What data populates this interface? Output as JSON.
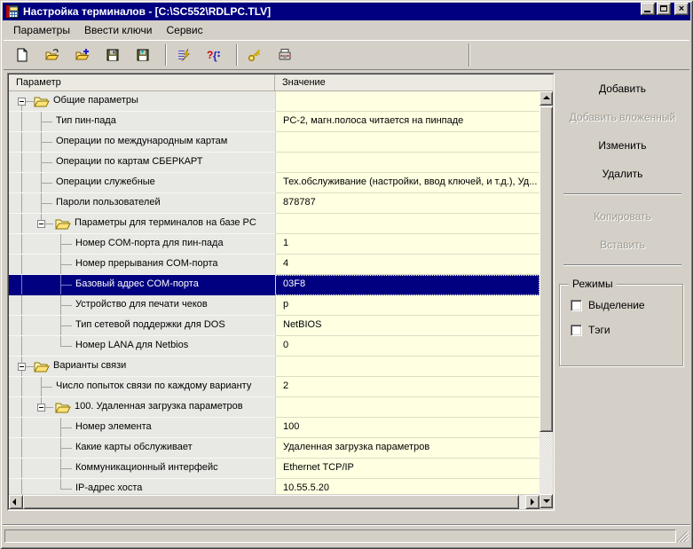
{
  "window": {
    "title": "Настройка терминалов - [C:\\SC552\\RDLPC.TLV]",
    "icon": "terminal-app-icon",
    "controls": [
      "minimize",
      "maximize",
      "close"
    ]
  },
  "menu": {
    "items": [
      {
        "label": "Параметры"
      },
      {
        "label": "Ввести ключи"
      },
      {
        "label": "Сервис"
      }
    ]
  },
  "toolbar": {
    "items": [
      {
        "type": "button",
        "icon": "new-file-icon"
      },
      {
        "type": "button",
        "icon": "open-file-icon"
      },
      {
        "type": "button",
        "icon": "open-append-icon"
      },
      {
        "type": "button",
        "icon": "save-icon"
      },
      {
        "type": "button",
        "icon": "save-as-icon"
      },
      {
        "type": "separator"
      },
      {
        "type": "button",
        "icon": "apply-params-icon"
      },
      {
        "type": "button",
        "icon": "help-syntax-icon"
      },
      {
        "type": "separator"
      },
      {
        "type": "button",
        "icon": "key-icon"
      },
      {
        "type": "button",
        "icon": "print-device-icon"
      }
    ]
  },
  "grid": {
    "columns": [
      "Параметр",
      "Значение"
    ],
    "rows": [
      {
        "level": 0,
        "kind": "group",
        "label": "Общие параметры",
        "value": ""
      },
      {
        "level": 1,
        "kind": "leaf",
        "label": "Тип пин-пада",
        "value": "PC-2, магн.полоса читается на пинпаде"
      },
      {
        "level": 1,
        "kind": "leaf",
        "label": "Операции по международным картам",
        "value": ""
      },
      {
        "level": 1,
        "kind": "leaf",
        "label": "Операции по картам СБЕРКАРТ",
        "value": ""
      },
      {
        "level": 1,
        "kind": "leaf",
        "label": "Операции служебные",
        "value": "Тех.обслуживание (настройки, ввод ключей, и т.д.), Уд..."
      },
      {
        "level": 1,
        "kind": "leaf",
        "label": "Пароли пользователей",
        "value": "878787"
      },
      {
        "level": 1,
        "kind": "group",
        "label": "Параметры для терминалов на базе PC",
        "value": ""
      },
      {
        "level": 2,
        "kind": "leaf",
        "label": "Номер COM-порта для пин-пада",
        "value": "1"
      },
      {
        "level": 2,
        "kind": "leaf",
        "label": "Номер прерывания COM-порта",
        "value": "4"
      },
      {
        "level": 2,
        "kind": "leaf",
        "label": "Базовый адрес COM-порта",
        "value": "03F8",
        "selected": true
      },
      {
        "level": 2,
        "kind": "leaf",
        "label": "Устройство для печати чеков",
        "value": "p"
      },
      {
        "level": 2,
        "kind": "leaf",
        "label": "Тип сетевой поддержки для DOS",
        "value": "NetBIOS"
      },
      {
        "level": 2,
        "kind": "leaf",
        "label": "Номер LANA для Netbios",
        "value": "0"
      },
      {
        "level": 0,
        "kind": "group",
        "label": "Варианты связи",
        "value": ""
      },
      {
        "level": 1,
        "kind": "leaf",
        "label": "Число попыток связи по каждому варианту",
        "value": "2"
      },
      {
        "level": 1,
        "kind": "group",
        "label": "100. Удаленная загрузка параметров",
        "value": ""
      },
      {
        "level": 2,
        "kind": "leaf",
        "label": "Номер элемента",
        "value": "100"
      },
      {
        "level": 2,
        "kind": "leaf",
        "label": "Какие карты обслуживает",
        "value": "Удаленная загрузка параметров"
      },
      {
        "level": 2,
        "kind": "leaf",
        "label": "Коммуникационный интерфейс",
        "value": "Ethernet TCP/IP"
      },
      {
        "level": 2,
        "kind": "leaf",
        "label": "IP-адрес хоста",
        "value": "10.55.5.20"
      }
    ]
  },
  "panel": {
    "items": [
      {
        "type": "button",
        "label": "Добавить",
        "enabled": true
      },
      {
        "type": "button",
        "label": "Добавить вложенный",
        "enabled": false
      },
      {
        "type": "button",
        "label": "Изменить",
        "enabled": true
      },
      {
        "type": "button",
        "label": "Удалить",
        "enabled": true
      },
      {
        "type": "separator"
      },
      {
        "type": "button",
        "label": "Копировать",
        "enabled": false
      },
      {
        "type": "button",
        "label": "Вставить",
        "enabled": false
      },
      {
        "type": "separator"
      }
    ],
    "modes": {
      "title": "Режимы",
      "checkboxes": [
        {
          "label": "Выделение",
          "checked": false
        },
        {
          "label": "Тэги",
          "checked": false
        }
      ]
    }
  },
  "status": {
    "text": ""
  },
  "colors": {
    "titlebar": "#000080",
    "selection": "#000080",
    "value_cell_bg": "#FFFFE1",
    "param_cell_bg": "#E8E8E4",
    "chrome": "#D4D0C8"
  }
}
